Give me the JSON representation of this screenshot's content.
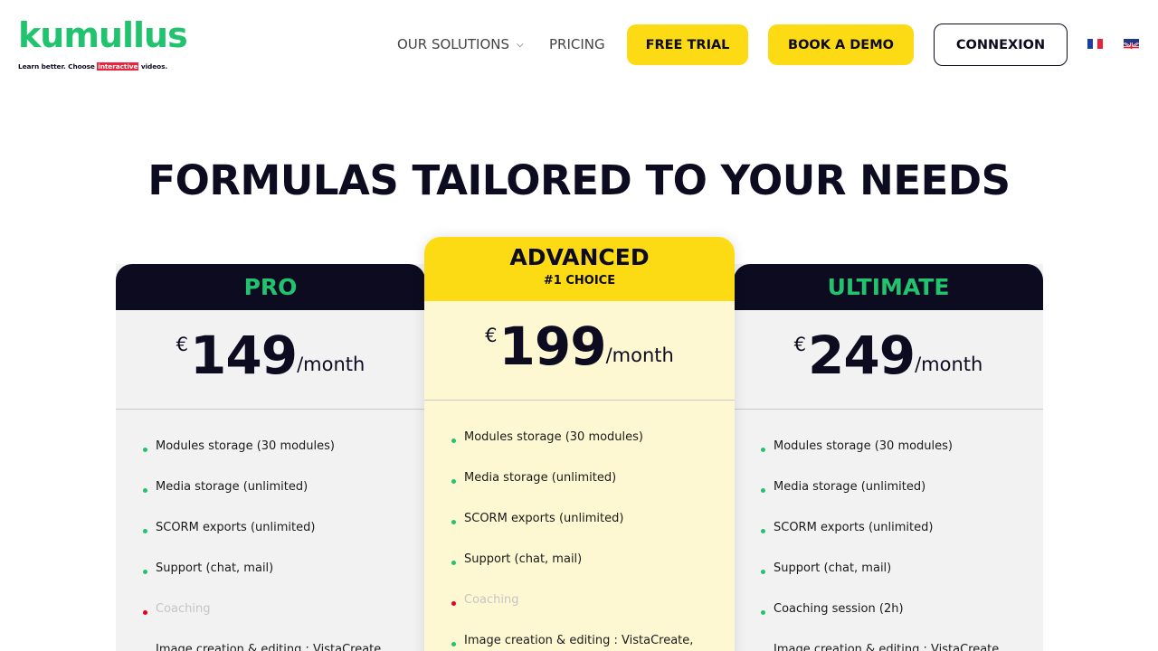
{
  "logo": {
    "word": "kumullus",
    "tagline_before": "Learn better. Choose ",
    "tagline_highlight": "interactive",
    "tagline_after": " videos."
  },
  "nav": {
    "solutions": "OUR SOLUTIONS",
    "pricing": "PRICING",
    "free_trial": "FREE TRIAL",
    "book_demo": "BOOK A DEMO",
    "login": "CONNEXION"
  },
  "icons": {
    "solutions_dropdown": "chevron-down-icon",
    "lang_fr": "flag-fr-icon",
    "lang_en": "flag-uk-icon"
  },
  "colors": {
    "brand_green": "#22c36e",
    "accent_yellow": "#fddb14",
    "dark_navy": "#0d0b20",
    "off_red": "#e8001c"
  },
  "title": "FORMULAS TAILORED TO YOUR NEEDS",
  "plans": [
    {
      "name": "PRO",
      "currency": "€",
      "price": "149",
      "period": "/month",
      "features": [
        {
          "text": "Modules storage (30 modules)",
          "included": true
        },
        {
          "text": "Media storage (unlimited)",
          "included": true
        },
        {
          "text": "SCORM exports (unlimited)",
          "included": true
        },
        {
          "text": "Support (chat, mail)",
          "included": true
        },
        {
          "text": "Coaching",
          "included": false
        },
        {
          "text": "Image creation & editing : VistaCreate",
          "included": true
        }
      ]
    },
    {
      "name": "ADVANCED",
      "badge": "#1 CHOICE",
      "currency": "€",
      "price": "199",
      "period": "/month",
      "features": [
        {
          "text": "Modules storage (30 modules)",
          "included": true
        },
        {
          "text": "Media storage (unlimited)",
          "included": true
        },
        {
          "text": "SCORM exports (unlimited)",
          "included": true
        },
        {
          "text": "Support (chat, mail)",
          "included": true
        },
        {
          "text": "Coaching",
          "included": false
        },
        {
          "text": "Image creation & editing : VistaCreate,",
          "included": true
        }
      ]
    },
    {
      "name": "ULTIMATE",
      "currency": "€",
      "price": "249",
      "period": "/month",
      "features": [
        {
          "text": "Modules storage (30 modules)",
          "included": true
        },
        {
          "text": "Media storage (unlimited)",
          "included": true
        },
        {
          "text": "SCORM exports (unlimited)",
          "included": true
        },
        {
          "text": "Support (chat, mail)",
          "included": true
        },
        {
          "text": "Coaching session (2h)",
          "included": true
        },
        {
          "text": "Image creation & editing : VistaCreate",
          "included": true
        }
      ]
    }
  ]
}
